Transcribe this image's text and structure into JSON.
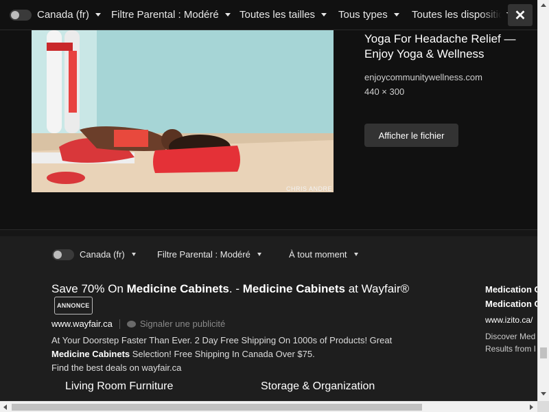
{
  "overlay_filters": {
    "region": "Canada (fr)",
    "safe_search": "Filtre Parental : Modéré",
    "size": "Toutes les tailles",
    "type": "Tous types",
    "layout": "Toutes les disposition",
    "close_icon": "✕"
  },
  "preview": {
    "title": "Yoga For Headache Relief — Enjoy Yoga & Wellness",
    "source": "enjoycommunitywellness.com",
    "dimensions": "440 × 300",
    "view_file_label": "Afficher le fichier",
    "image_credit": "CHRIS ANDRE",
    "image_subject": "woman lying on back with legs up the wall on red blanket"
  },
  "results_filters": {
    "region": "Canada (fr)",
    "safe_search": "Filtre Parental : Modéré",
    "time": "À tout moment"
  },
  "ad": {
    "title_pre": "Save 70% On ",
    "title_b1": "Medicine Cabinets",
    "title_mid": ". - ",
    "title_b2": "Medicine Cabinets",
    "title_post": " at Wayfair®",
    "badge": "ANNONCE",
    "url": "www.wayfair.ca",
    "report_label": "Signaler une publicité",
    "desc_1": "At Your Doorstep Faster Than Ever. 2 Day Free Shipping On 1000s of Products! Great",
    "desc_b": "Medicine Cabinets",
    "desc_2": " Selection! Free Shipping In Canada Over $75.",
    "desc_3": "Find the best deals on wayfair.ca",
    "sitelinks": [
      "Living Room Furniture",
      "Storage & Organization"
    ]
  },
  "side_ad": {
    "title_1": "Medication C",
    "title_2": "Medication C",
    "url": "www.izito.ca/",
    "desc_1": "Discover Med",
    "desc_2": "Results from I"
  },
  "colors": {
    "background": "#1e1e1e",
    "overlay": "#111111",
    "button": "#333333"
  }
}
